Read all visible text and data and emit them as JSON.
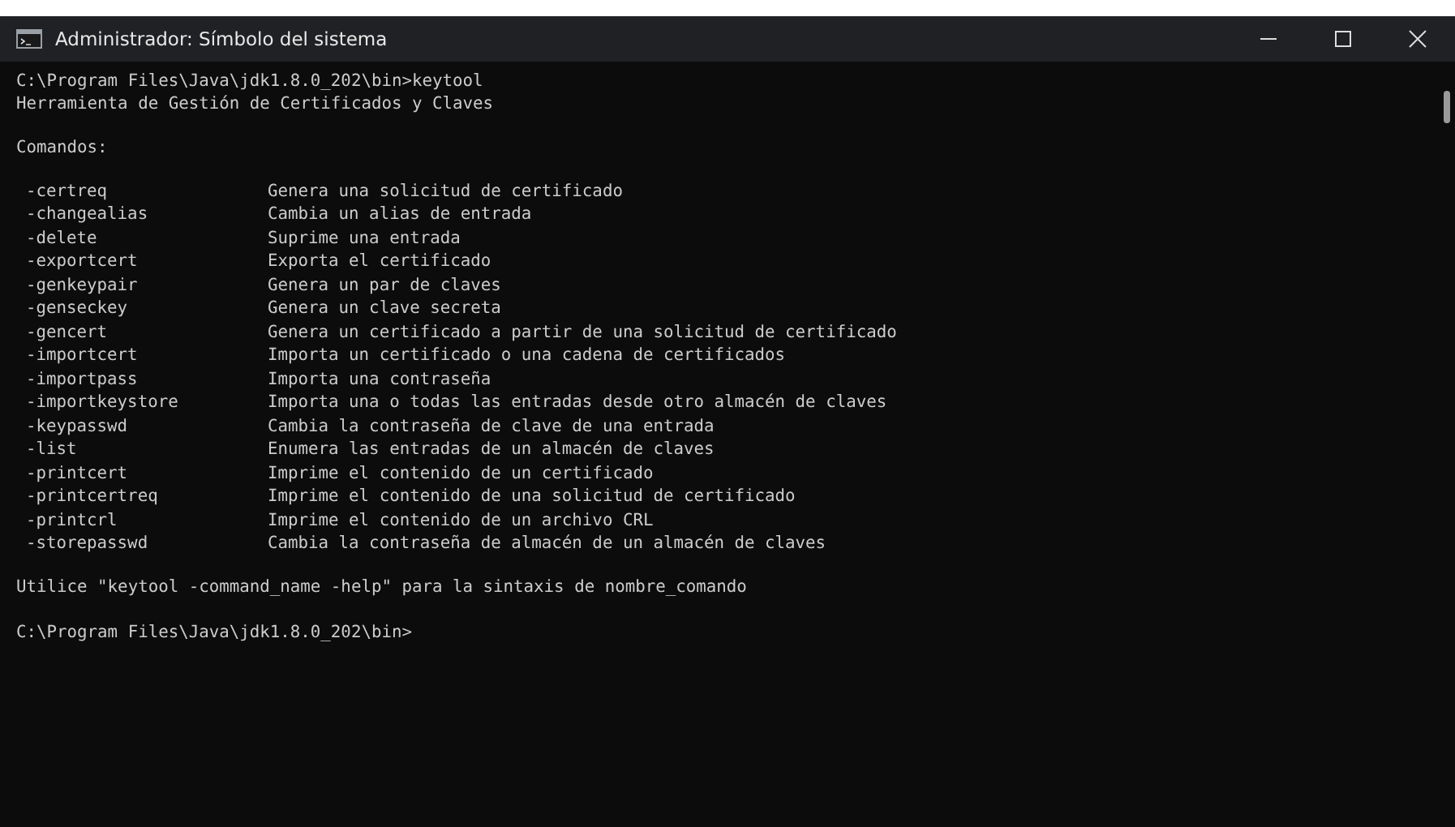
{
  "window": {
    "title": "Administrador: Símbolo del sistema"
  },
  "console": {
    "prompt_line": "C:\\Program Files\\Java\\jdk1.8.0_202\\bin>keytool",
    "heading": "Herramienta de Gestión de Certificados y Claves",
    "commands_label": "Comandos:",
    "commands": [
      {
        "name": "-certreq",
        "description": "Genera una solicitud de certificado"
      },
      {
        "name": "-changealias",
        "description": "Cambia un alias de entrada"
      },
      {
        "name": "-delete",
        "description": "Suprime una entrada"
      },
      {
        "name": "-exportcert",
        "description": "Exporta el certificado"
      },
      {
        "name": "-genkeypair",
        "description": "Genera un par de claves"
      },
      {
        "name": "-genseckey",
        "description": "Genera un clave secreta"
      },
      {
        "name": "-gencert",
        "description": "Genera un certificado a partir de una solicitud de certificado"
      },
      {
        "name": "-importcert",
        "description": "Importa un certificado o una cadena de certificados"
      },
      {
        "name": "-importpass",
        "description": "Importa una contraseña"
      },
      {
        "name": "-importkeystore",
        "description": "Importa una o todas las entradas desde otro almacén de claves"
      },
      {
        "name": "-keypasswd",
        "description": "Cambia la contraseña de clave de una entrada"
      },
      {
        "name": "-list",
        "description": "Enumera las entradas de un almacén de claves"
      },
      {
        "name": "-printcert",
        "description": "Imprime el contenido de un certificado"
      },
      {
        "name": "-printcertreq",
        "description": "Imprime el contenido de una solicitud de certificado"
      },
      {
        "name": "-printcrl",
        "description": "Imprime el contenido de un archivo CRL"
      },
      {
        "name": "-storepasswd",
        "description": "Cambia la contraseña de almacén de un almacén de claves"
      }
    ],
    "usage": "Utilice \"keytool -command_name -help\" para la sintaxis de nombre_comando",
    "prompt": "C:\\Program Files\\Java\\jdk1.8.0_202\\bin>"
  }
}
